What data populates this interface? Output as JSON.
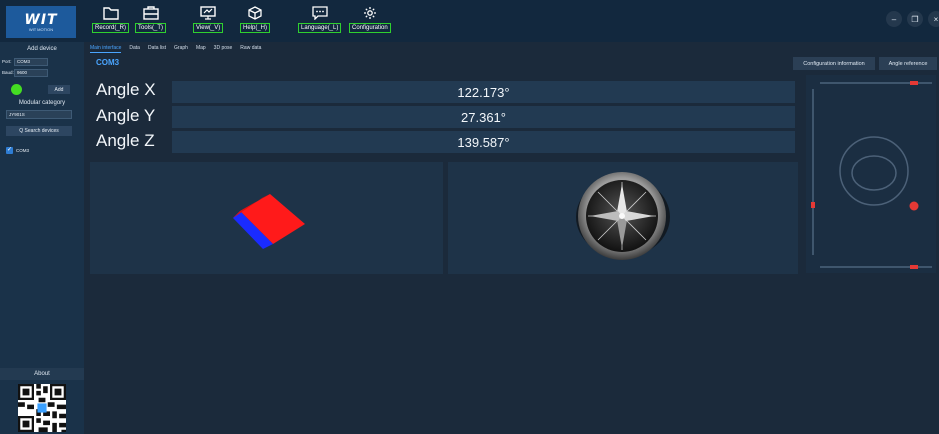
{
  "app": {
    "logo_text": "WIT",
    "logo_sub": "WIT MOTION"
  },
  "toolbar": {
    "items": [
      {
        "label": "Record(_R)",
        "icon": "folder-icon"
      },
      {
        "label": "Tools(_T)",
        "icon": "toolbox-icon"
      },
      {
        "label": "View(_V)",
        "icon": "monitor-icon"
      },
      {
        "label": "Help(_H)",
        "icon": "cube-icon"
      },
      {
        "label": "Language(_L)",
        "icon": "chat-icon"
      },
      {
        "label": "Configuration",
        "icon": "gear-icon"
      }
    ],
    "highlight_color": "#2fd02f"
  },
  "window": {
    "minimize": "–",
    "restore": "❐",
    "close": "×"
  },
  "sidebar": {
    "add_device_title": "Add device",
    "port_label": "Port:",
    "port_value": "COM3",
    "baud_label": "Baud:",
    "baud_value": "9600",
    "add_button": "Add",
    "modular_category_title": "Modular category",
    "category_value": "JY901S",
    "search_button": "Q Search devices",
    "device_item": "COM3",
    "about": "About"
  },
  "tabs": [
    "Main interface",
    "Data",
    "Data list",
    "Graph",
    "Map",
    "3D pose",
    "Raw data"
  ],
  "main": {
    "device_label": "COM3",
    "config_info_button": "Configuration information",
    "angle_reference_button": "Angle reference",
    "angles": [
      {
        "label": "Angle X",
        "value": "122.173°"
      },
      {
        "label": "Angle Y",
        "value": "27.361°"
      },
      {
        "label": "Angle Z",
        "value": "139.587°"
      }
    ]
  },
  "colors": {
    "accent": "#4aa5ff",
    "status_green": "#44dd22",
    "marker_red": "#e53935",
    "cube_red": "#ff1a1a",
    "cube_blue": "#1a2bff"
  }
}
